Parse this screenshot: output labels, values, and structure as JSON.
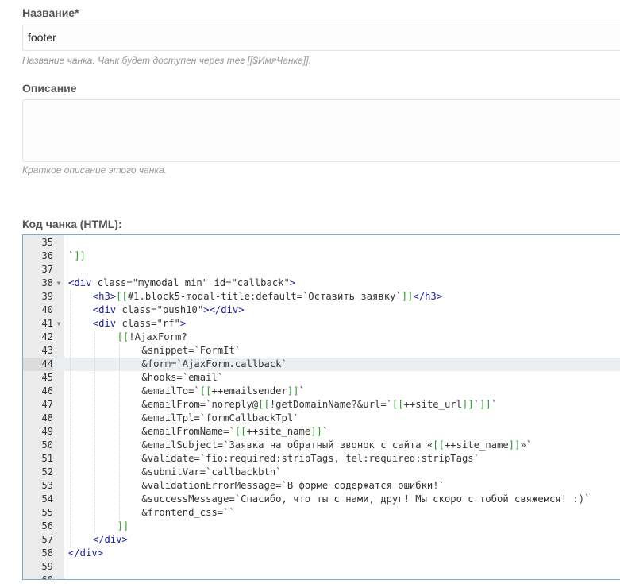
{
  "name_field": {
    "label": "Название",
    "required_mark": "*",
    "value": "footer",
    "hint": "Название чанка. Чанк будет доступен через тег [[$ИмяЧанка]]."
  },
  "description_field": {
    "label": "Описание",
    "value": "",
    "hint": "Краткое описание этого чанка."
  },
  "code_field": {
    "label": "Код чанка (HTML):",
    "active_line": "44",
    "lines": [
      {
        "n": "35",
        "fold": false,
        "indent": 0,
        "text": ""
      },
      {
        "n": "36",
        "fold": false,
        "indent": 0,
        "text": "`]]"
      },
      {
        "n": "37",
        "fold": false,
        "indent": 0,
        "text": ""
      },
      {
        "n": "38",
        "fold": true,
        "indent": 0,
        "text": "<div class=\"mymodal min\" id=\"callback\">"
      },
      {
        "n": "39",
        "fold": false,
        "indent": 1,
        "text": "<h3>[[#1.block5-modal-title:default=`Оставить заявку`]]</h3>"
      },
      {
        "n": "40",
        "fold": false,
        "indent": 1,
        "text": "<div class=\"push10\"></div>"
      },
      {
        "n": "41",
        "fold": true,
        "indent": 1,
        "text": "<div class=\"rf\">"
      },
      {
        "n": "42",
        "fold": false,
        "indent": 2,
        "text": "[[!AjaxForm?"
      },
      {
        "n": "43",
        "fold": false,
        "indent": 3,
        "text": "&snippet=`FormIt`"
      },
      {
        "n": "44",
        "fold": false,
        "indent": 3,
        "text": "&form=`AjaxForm.callback`"
      },
      {
        "n": "45",
        "fold": false,
        "indent": 3,
        "text": "&hooks=`email`"
      },
      {
        "n": "46",
        "fold": false,
        "indent": 3,
        "text": "&emailTo=`[[++emailsender]]`"
      },
      {
        "n": "47",
        "fold": false,
        "indent": 3,
        "text": "&emailFrom=`noreply@[[!getDomainName?&url=`[[++site_url]]`]]`"
      },
      {
        "n": "48",
        "fold": false,
        "indent": 3,
        "text": "&emailTpl=`formCallbackTpl`"
      },
      {
        "n": "49",
        "fold": false,
        "indent": 3,
        "text": "&emailFromName=`[[++site_name]]`"
      },
      {
        "n": "50",
        "fold": false,
        "indent": 3,
        "text": "&emailSubject=`Заявка на обратный звонок с сайта «[[++site_name]]»`"
      },
      {
        "n": "51",
        "fold": false,
        "indent": 3,
        "text": "&validate=`fio:required:stripTags, tel:required:stripTags`"
      },
      {
        "n": "52",
        "fold": false,
        "indent": 3,
        "text": "&submitVar=`callbackbtn`"
      },
      {
        "n": "53",
        "fold": false,
        "indent": 3,
        "text": "&validationErrorMessage=`В форме содержатся ошибки!`"
      },
      {
        "n": "54",
        "fold": false,
        "indent": 3,
        "text": "&successMessage=`Спасибо, что ты с нами, друг! Мы скоро с тобой свяжемся! :)`"
      },
      {
        "n": "55",
        "fold": false,
        "indent": 3,
        "text": "&frontend_css=``"
      },
      {
        "n": "56",
        "fold": false,
        "indent": 2,
        "text": "]]"
      },
      {
        "n": "57",
        "fold": false,
        "indent": 1,
        "text": "</div>"
      },
      {
        "n": "58",
        "fold": false,
        "indent": 0,
        "text": "</div>"
      },
      {
        "n": "59",
        "fold": false,
        "indent": 0,
        "text": ""
      },
      {
        "n": "60",
        "fold": false,
        "indent": 0,
        "text": ""
      }
    ]
  }
}
